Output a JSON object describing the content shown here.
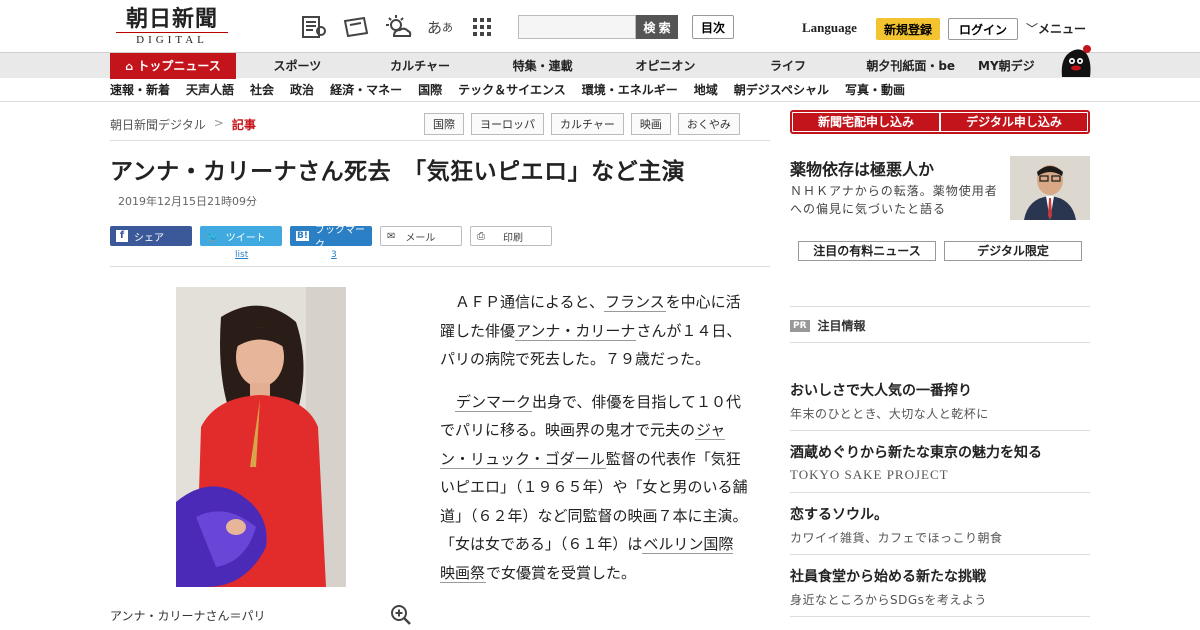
{
  "header": {
    "logo_main": "朝日新聞",
    "logo_sub": "DIGITAL",
    "search_placeholder": "",
    "search_button": "検 索",
    "toc_button": "目次",
    "language": "Language",
    "register": "新規登録",
    "login": "ログイン",
    "menu": "メニュー"
  },
  "nav": {
    "items": [
      "トップニュース",
      "スポーツ",
      "カルチャー",
      "特集・連載",
      "オピニオン",
      "ライフ",
      "朝夕刊紙面・be",
      "MY朝デジ"
    ]
  },
  "subnav": {
    "items": [
      "速報・新着",
      "天声人語",
      "社会",
      "政治",
      "経済・マネー",
      "国際",
      "テック＆サイエンス",
      "環境・エネルギー",
      "地域",
      "朝デジスペシャル",
      "写真・動画"
    ]
  },
  "breadcrumb": {
    "root": "朝日新聞デジタル",
    "sep": ">",
    "current": "記事"
  },
  "tags": [
    "国際",
    "ヨーロッパ",
    "カルチャー",
    "映画",
    "おくやみ"
  ],
  "article": {
    "title": "アンナ・カリーナさん死去　「気狂いピエロ」など主演",
    "date": "2019年12月15日21時09分",
    "share": {
      "facebook": "シェア",
      "twitter": "ツイート",
      "hatena": "ブックマーク",
      "mail": "メール",
      "print": "印刷",
      "twitter_count": "list",
      "hatena_count": "3"
    },
    "caption": "アンナ・カリーナさん＝パリ",
    "p1": {
      "a": "ＡＦＰ通信によると、",
      "l1": "フランス",
      "b": "を中心に活躍した俳優",
      "l2": "アンナ・カリーナ",
      "c": "さんが１４日、パリの病院で死去した。７９歳だった。"
    },
    "p2": {
      "l1": "デンマーク",
      "a": "出身で、俳優を目指して１０代でパリに移る。映画界の鬼才で元夫の",
      "l2": "ジャン・リュック・ゴダール",
      "b": "監督の代表作「気狂いピエロ」（１９６５年）や「女と男のいる舗道」（６２年）など同監督の映画７本に主演。「女は女である」（６１年）は",
      "l3": "ベルリン国際映画祭",
      "c": "で女優賞を受賞した。"
    }
  },
  "sidebar": {
    "btn_newspaper": "新聞宅配申し込み",
    "btn_digital": "デジタル申し込み",
    "feature_title": "薬物依存は極悪人か",
    "feature_desc": "ＮＨＫアナからの転落。薬物使用者への偏見に気づいたと語る",
    "tab_paid": "注目の有料ニュース",
    "tab_digital": "デジタル限定",
    "pr_badge": "PR",
    "pr_label": "注目情報",
    "pr_items": [
      {
        "title": "おいしさで大人気の一番搾り",
        "sub": "年末のひととき、大切な人と乾杯に"
      },
      {
        "title": "酒蔵めぐりから新たな東京の魅力を知る",
        "sub": "TOKYO SAKE PROJECT"
      },
      {
        "title": "恋するソウル。",
        "sub": "カワイイ雑貨、カフェでほっこり朝食"
      },
      {
        "title": "社員食堂から始める新たな挑戦",
        "sub": "身近なところからSDGsを考えよう"
      }
    ]
  },
  "colors": {
    "brand_red": "#c4141b",
    "accent_yellow": "#f4c430",
    "facebook": "#3b5998",
    "twitter": "#3fa9e0",
    "hatena": "#2b7fc4"
  }
}
